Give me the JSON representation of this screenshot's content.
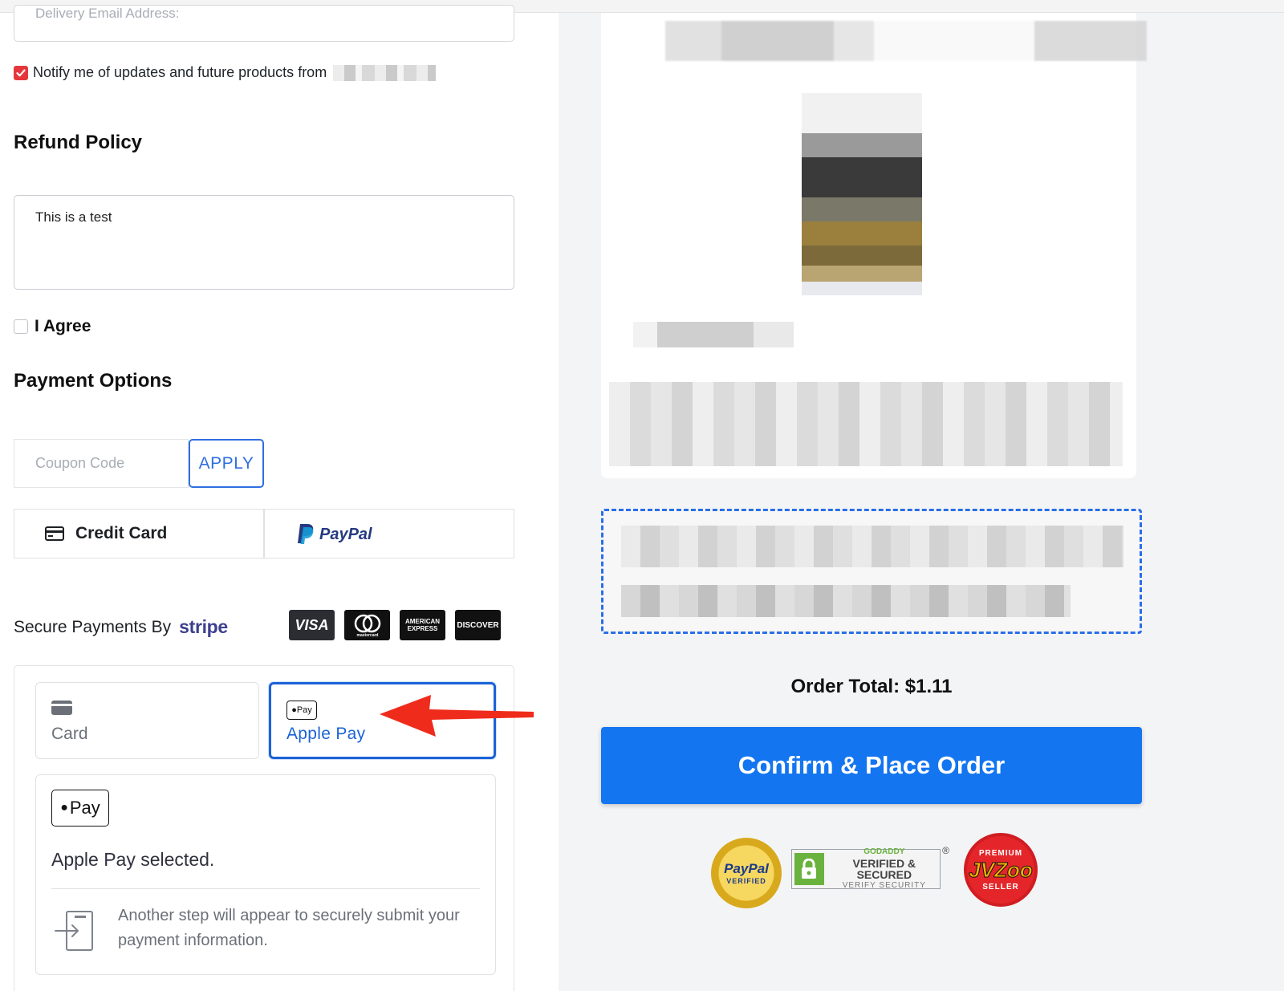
{
  "form": {
    "delivery_email_placeholder": "Delivery Email Address:",
    "notify_label": "Notify me of updates and future products from",
    "notify_checked": true
  },
  "refund": {
    "heading": "Refund Policy",
    "text": "This is a test",
    "agree_label": "I Agree",
    "agree_checked": false
  },
  "payment": {
    "heading": "Payment Options",
    "coupon_placeholder": "Coupon Code",
    "apply_label": "APPLY",
    "methods": [
      {
        "label": "Credit Card",
        "icon": "credit-card-icon"
      },
      {
        "label": "PayPal",
        "icon": "paypal-logo"
      }
    ],
    "secure_text": "Secure Payments By",
    "stripe_label": "stripe",
    "card_logos": [
      "VISA",
      "mastercard",
      "AMERICAN EXPRESS",
      "DISCOVER"
    ]
  },
  "stripe_element": {
    "tabs": [
      {
        "label": "Card",
        "icon": "card-icon",
        "selected": false
      },
      {
        "label": "Apple Pay",
        "icon": "apple-pay-icon",
        "selected": true
      }
    ],
    "apple_pay_mark": "Pay",
    "selected_text": "Apple Pay selected.",
    "step_text": "Another step will appear to securely submit your payment information."
  },
  "order": {
    "total_label": "Order Total: $1.11",
    "confirm_label": "Confirm & Place Order"
  },
  "badges": {
    "paypal": {
      "line1": "PayPal",
      "line2": "VERIFIED"
    },
    "godaddy": {
      "line1": "GODADDY",
      "line2": "VERIFIED & SECURED",
      "line3": "VERIFY SECURITY",
      "reg": "®"
    },
    "jvzoo": {
      "line1": "PREMIUM",
      "line2": "JVZoo",
      "line3": "SELLER"
    }
  },
  "colors": {
    "accent_blue": "#1475f0",
    "selected_tab_blue": "#1a63d6",
    "checkbox_red": "#e5373b",
    "arrow_red": "#ef2b1c",
    "dashed_border": "#2a6ee8"
  }
}
